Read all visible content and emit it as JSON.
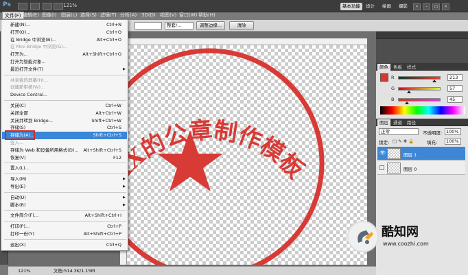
{
  "app": {
    "logo": "Ps",
    "zoom": "121%"
  },
  "menus": [
    "文件(F)",
    "编辑(E)",
    "图像(I)",
    "图层(L)",
    "选择(S)",
    "滤镜(T)",
    "分析(A)",
    "3D(D)",
    "视图(V)",
    "窗口(W)",
    "帮助(H)"
  ],
  "workspaces": {
    "active": "基本功能",
    "items": [
      "设计",
      "绘画",
      "摄影"
    ]
  },
  "window_buttons": [
    "»",
    "–",
    "□",
    "×"
  ],
  "options": {
    "style_value": "整套/...",
    "refine_edge": "调整边缘...",
    "clear": "清除"
  },
  "file_menu": [
    {
      "label": "新建(N)...",
      "shortcut": "Ctrl+N"
    },
    {
      "label": "打开(O)...",
      "shortcut": "Ctrl+O"
    },
    {
      "label": "在 Bridge 中浏览(B)...",
      "shortcut": "Alt+Ctrl+O"
    },
    {
      "label": "在 Mini Bridge 中浏览(G)...",
      "shortcut": "",
      "disabled": true
    },
    {
      "label": "打开为...",
      "shortcut": "Alt+Shift+Ctrl+O"
    },
    {
      "label": "打开为智能对象...",
      "shortcut": ""
    },
    {
      "label": "最近打开文件(T)",
      "shortcut": "",
      "submenu": true
    },
    {
      "label": "共享我的屏幕(H)...",
      "shortcut": "",
      "disabled": true
    },
    {
      "label": "创建新审核(W)...",
      "shortcut": "",
      "disabled": true
    },
    {
      "label": "Device Central...",
      "shortcut": ""
    },
    {
      "label": "关闭(C)",
      "shortcut": "Ctrl+W"
    },
    {
      "label": "关闭全部",
      "shortcut": "Alt+Ctrl+W"
    },
    {
      "label": "关闭并转到 Bridge...",
      "shortcut": "Shift+Ctrl+W"
    },
    {
      "label": "存储(S)",
      "shortcut": "Ctrl+S"
    },
    {
      "label": "存储为(A)...",
      "shortcut": "Shift+Ctrl+S",
      "highlight": true
    },
    {
      "label": "签入...",
      "shortcut": "",
      "disabled": true
    },
    {
      "label": "存储为 Web 和设备所用格式(D)...",
      "shortcut": "Alt+Shift+Ctrl+S"
    },
    {
      "label": "恢复(V)",
      "shortcut": "F12"
    },
    {
      "label": "置入(L)...",
      "shortcut": ""
    },
    {
      "label": "导入(M)",
      "shortcut": "",
      "submenu": true
    },
    {
      "label": "导出(E)",
      "shortcut": "",
      "submenu": true
    },
    {
      "label": "自动(U)",
      "shortcut": "",
      "submenu": true
    },
    {
      "label": "脚本(R)",
      "shortcut": "",
      "submenu": true
    },
    {
      "label": "文件简介(F)...",
      "shortcut": "Alt+Shift+Ctrl+I"
    },
    {
      "label": "打印(P)...",
      "shortcut": "Ctrl+P"
    },
    {
      "label": "打印一份(Y)",
      "shortcut": "Alt+Shift+Ctrl+P"
    },
    {
      "label": "退出(X)",
      "shortcut": "Ctrl+Q"
    }
  ],
  "stamp": {
    "text": "XX的公章制作模板",
    "color": "#d83a36"
  },
  "color_panel": {
    "tabs": [
      "颜色",
      "色板",
      "样式"
    ],
    "r": "213",
    "g": "57",
    "b": "45"
  },
  "layers_panel": {
    "tabs": [
      "图层",
      "通道",
      "路径"
    ],
    "blend_mode": "正常",
    "opacity_label": "不透明度:",
    "opacity": "100%",
    "lock_label": "锁定:",
    "fill_label": "填充:",
    "fill": "100%",
    "layers": [
      {
        "name": "图层 1",
        "selected": true
      },
      {
        "name": "图层 0",
        "selected": false
      }
    ]
  },
  "status": {
    "zoom": "121%",
    "doc": "文档:514.3K/1.15M"
  },
  "watermark": {
    "title": "酷知网",
    "url": "www.coozhi.com"
  }
}
